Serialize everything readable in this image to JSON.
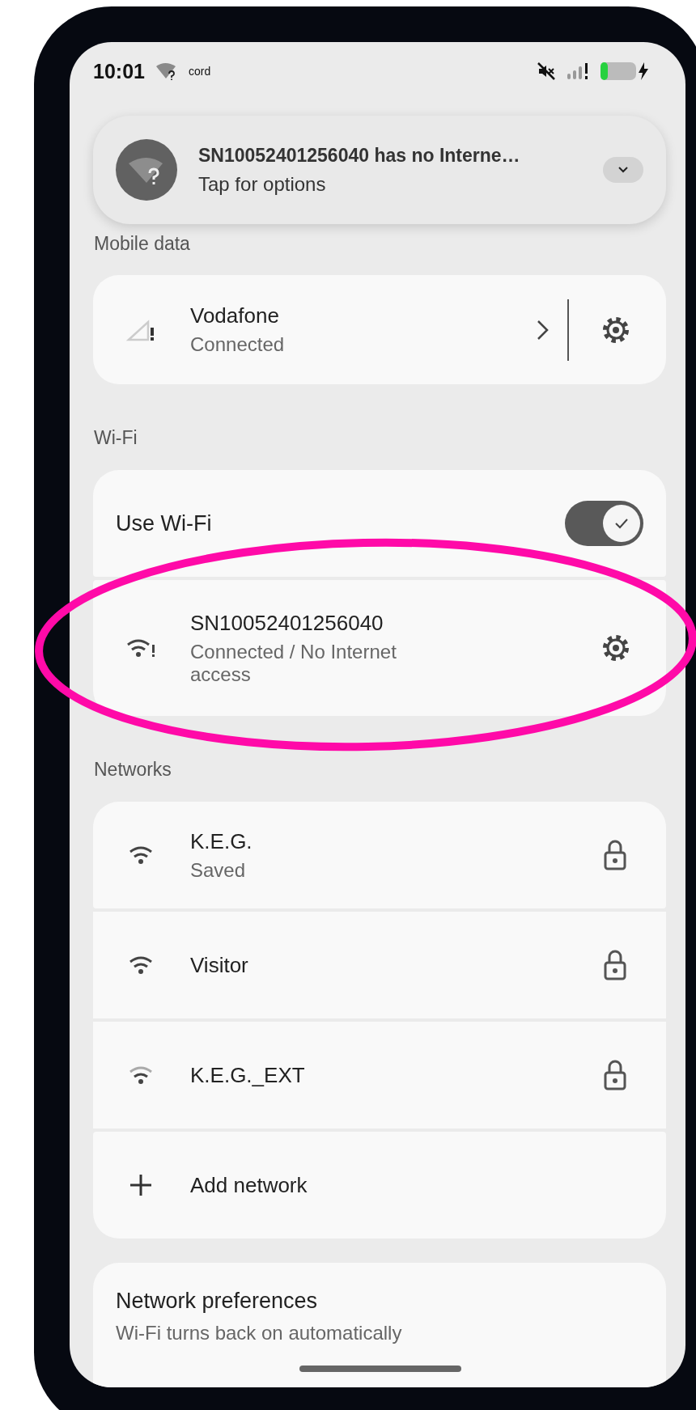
{
  "status_bar": {
    "time": "10:01",
    "carrier": "cord"
  },
  "notification": {
    "title": "SN10052401256040 has no Interne…",
    "subtitle": "Tap for options"
  },
  "mobile_data": {
    "heading": "Mobile data",
    "name": "Vodafone",
    "status": "Connected"
  },
  "wifi": {
    "heading": "Wi-Fi",
    "toggle": {
      "label": "Use Wi-Fi",
      "on": true
    },
    "connected": {
      "name": "SN10052401256040",
      "status": "Connected / No Internet access"
    }
  },
  "networks": {
    "heading": "Networks",
    "items": [
      {
        "kind": "wifi",
        "name": "K.E.G.",
        "status": "Saved",
        "weak": false,
        "locked": true
      },
      {
        "kind": "wifi",
        "name": "Visitor",
        "weak": false,
        "locked": true
      },
      {
        "kind": "wifi",
        "name": "K.E.G._EXT",
        "weak": true,
        "locked": true
      },
      {
        "kind": "add",
        "name": "Add network"
      }
    ]
  },
  "preferences": {
    "title": "Network preferences",
    "subtitle": "Wi-Fi turns back on automatically"
  }
}
